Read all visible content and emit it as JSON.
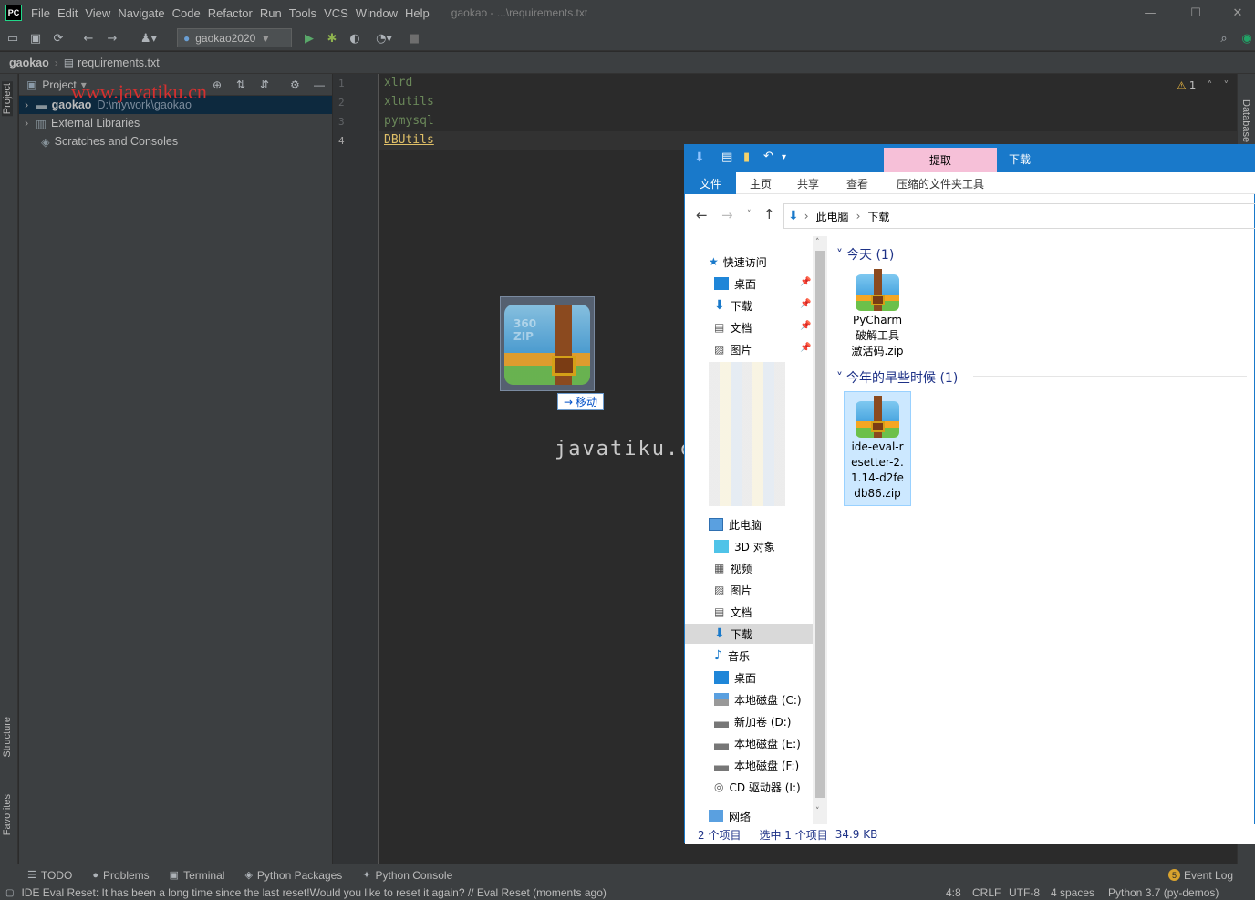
{
  "app": {
    "logo_text": "PC",
    "window_title": "gaokao - ...\\requirements.txt"
  },
  "menu": [
    "File",
    "Edit",
    "View",
    "Navigate",
    "Code",
    "Refactor",
    "Run",
    "Tools",
    "VCS",
    "Window",
    "Help"
  ],
  "toolbar": {
    "run_config": "gaokao2020"
  },
  "breadcrumb": {
    "project": "gaokao",
    "file": "requirements.txt"
  },
  "left_stripe": {
    "project": "Project",
    "structure": "Structure",
    "favorites": "Favorites"
  },
  "right_stripe": {
    "database": "Database"
  },
  "project_panel": {
    "title": "Project",
    "root_name": "gaokao",
    "root_path": "D:\\mywork\\gaokao",
    "external_libraries": "External Libraries",
    "scratches": "Scratches and Consoles"
  },
  "editor": {
    "lines": [
      "xlrd",
      "xlutils",
      "pymysql",
      "DBUtils"
    ],
    "line_numbers": [
      "1",
      "2",
      "3",
      "4"
    ],
    "warnings": "1"
  },
  "drag": {
    "tooltip": "移动",
    "ghost_label": "360 ZIP"
  },
  "watermarks": {
    "center": "javatiku.cn",
    "top": "www.javatiku.cn"
  },
  "explorer": {
    "title": "下载",
    "extract_tab": "提取",
    "ribbon_tabs": [
      "文件",
      "主页",
      "共享",
      "查看",
      "压缩的文件夹工具"
    ],
    "address": [
      "此电脑",
      "下载"
    ],
    "nav": {
      "quick_access": "快速访问",
      "quick_items": [
        "桌面",
        "下载",
        "文档",
        "图片"
      ],
      "this_pc": "此电脑",
      "pc_items": [
        "3D 对象",
        "视频",
        "图片",
        "文档",
        "下载",
        "音乐",
        "桌面"
      ],
      "drives": [
        "本地磁盘 (C:)",
        "新加卷 (D:)",
        "本地磁盘 (E:)",
        "本地磁盘 (F:)",
        "CD 驱动器 (I:)"
      ],
      "network": "网络"
    },
    "groups": [
      {
        "title": "今天 (1)",
        "files": [
          "PyCharm破解工具激活码.zip"
        ]
      },
      {
        "title": "今年的早些时候 (1)",
        "files": [
          "ide-eval-resetter-2.1.14-d2fedb86.zip"
        ]
      }
    ],
    "file1_lines": [
      "PyCharm",
      "破解工具",
      "激活码.zip"
    ],
    "file2_lines": [
      "ide-eval-r",
      "esetter-2.",
      "1.14-d2fe",
      "db86.zip"
    ],
    "status": {
      "count": "2 个项目",
      "selected": "选中 1 个项目",
      "size": "34.9 KB"
    }
  },
  "tool_tabs": [
    "TODO",
    "Problems",
    "Terminal",
    "Python Packages",
    "Python Console"
  ],
  "event_log": {
    "badge": "5",
    "label": "Event Log"
  },
  "statusbar": {
    "message": "IDE Eval Reset: It has been a long time since the last reset!Would you like to reset it again? // Eval Reset (moments ago)",
    "position": "4:8",
    "line_sep": "CRLF",
    "encoding": "UTF-8",
    "indent": "4 spaces",
    "interpreter": "Python 3.7 (py-demos)"
  }
}
